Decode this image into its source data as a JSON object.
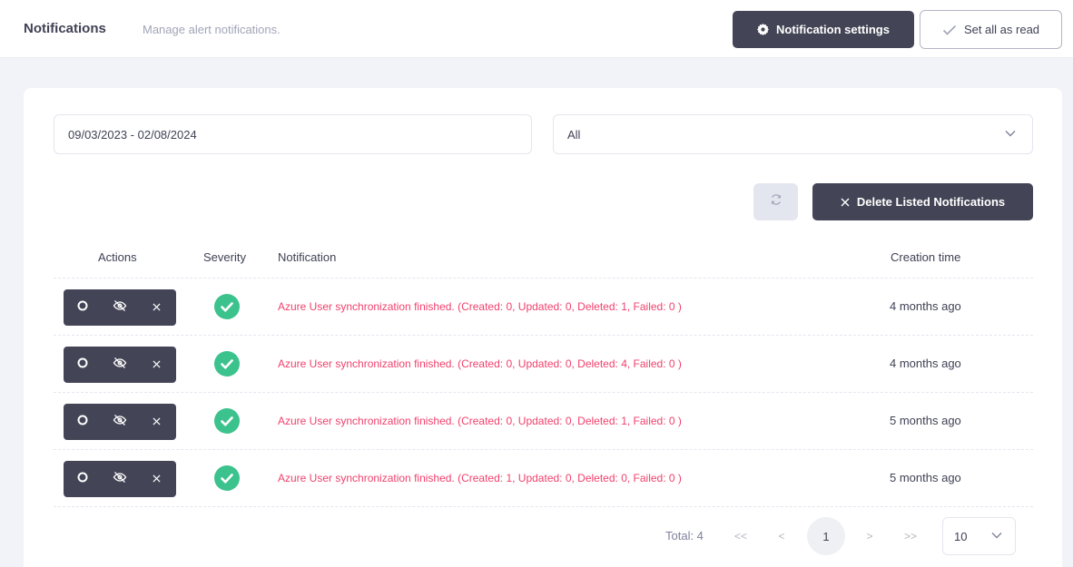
{
  "header": {
    "title": "Notifications",
    "subtitle": "Manage alert notifications.",
    "settings_button": "Notification settings",
    "set_read_button": "Set all as read"
  },
  "filters": {
    "date_range": "09/03/2023 - 02/08/2024",
    "type_select": "All"
  },
  "toolbar": {
    "delete_button": "Delete Listed Notifications"
  },
  "table": {
    "columns": [
      "Actions",
      "Severity",
      "Notification",
      "Creation time"
    ],
    "rows": [
      {
        "severity": "success",
        "notification": "Azure User synchronization finished. (Created: 0, Updated: 0, Deleted: 1, Failed: 0 )",
        "created": "4 months ago"
      },
      {
        "severity": "success",
        "notification": "Azure User synchronization finished. (Created: 0, Updated: 0, Deleted: 4, Failed: 0 )",
        "created": "4 months ago"
      },
      {
        "severity": "success",
        "notification": "Azure User synchronization finished. (Created: 0, Updated: 0, Deleted: 1, Failed: 0 )",
        "created": "5 months ago"
      },
      {
        "severity": "success",
        "notification": "Azure User synchronization finished. (Created: 1, Updated: 0, Deleted: 0, Failed: 0 )",
        "created": "5 months ago"
      }
    ]
  },
  "pagination": {
    "total_label": "Total: 4",
    "first": "<<",
    "prev": "<",
    "current_page": "1",
    "next": ">",
    "last": ">>",
    "page_size": "10"
  },
  "colors": {
    "dark_button": "#434556",
    "error_text": "#f1416c",
    "success": "#3cc28d"
  }
}
